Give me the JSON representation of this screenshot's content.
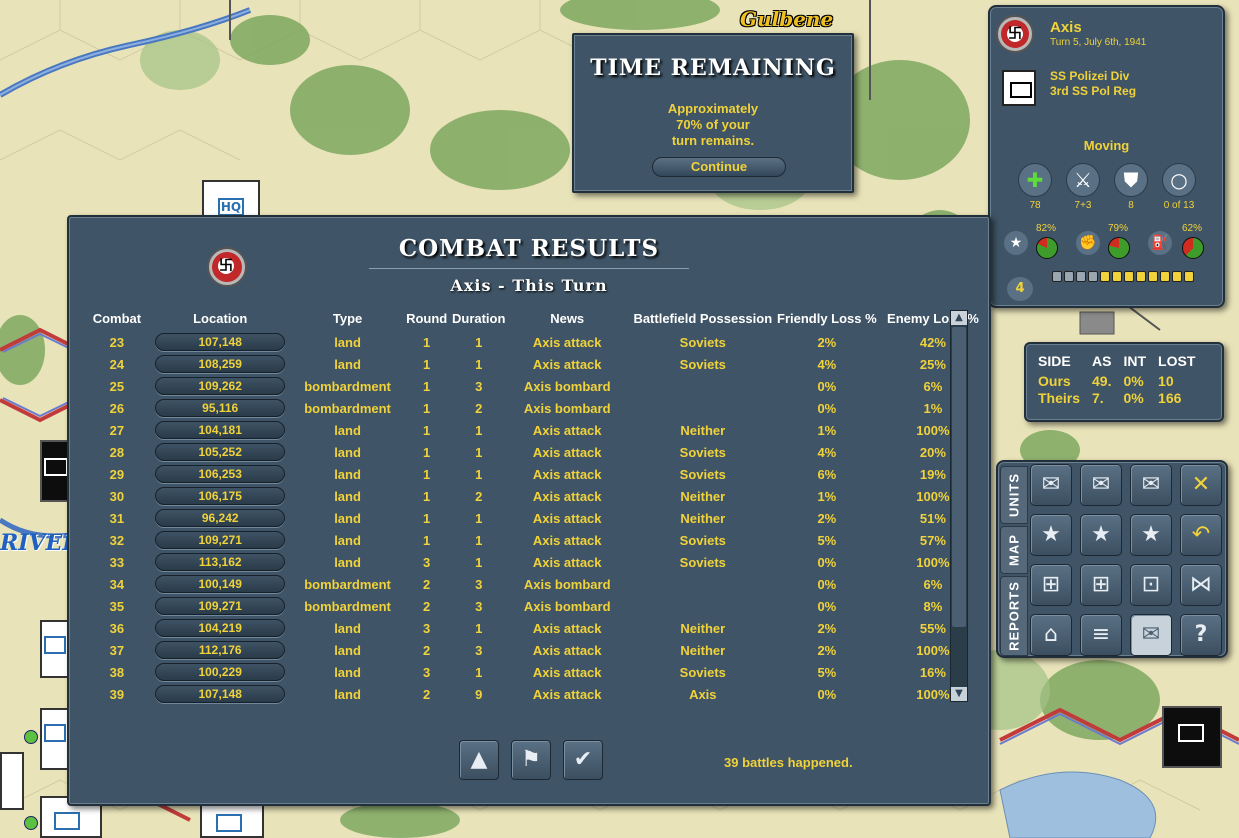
{
  "map": {
    "city_label": "Gulbene",
    "river_label": "RIVER"
  },
  "time_dialog": {
    "title": "TIME REMAINING",
    "line1": "Approximately",
    "line2": "70% of your",
    "line3": "turn remains.",
    "continue_label": "Continue"
  },
  "unit_panel": {
    "side": "Axis",
    "turn": "Turn 5, July 6th, 1941",
    "unit_line1": "SS Polizei Div",
    "unit_line2": "3rd SS Pol Reg",
    "status": "Moving",
    "stats": [
      {
        "icon": "health-cross-icon",
        "value": "78"
      },
      {
        "icon": "crossed-swords-icon",
        "value": "7+3"
      },
      {
        "icon": "shield-icon",
        "value": "8"
      },
      {
        "icon": "circle-icon",
        "value": "0 of 13"
      }
    ],
    "percentages": [
      {
        "icon": "star-icon",
        "value": "82%",
        "fraction": 0.82
      },
      {
        "icon": "fist-icon",
        "value": "79%",
        "fraction": 0.79
      },
      {
        "icon": "fuel-can-icon",
        "value": "62%",
        "fraction": 0.62
      }
    ],
    "morale": "4",
    "supply_segments": {
      "filled": 8,
      "total": 12
    }
  },
  "summary": {
    "headers": [
      "SIDE",
      "AS",
      "INT",
      "LOST"
    ],
    "rows": [
      [
        "Ours",
        "49.",
        "0%",
        "10"
      ],
      [
        "Theirs",
        "7.",
        "0%",
        "166"
      ]
    ]
  },
  "command_tabs": [
    "UNITS",
    "MAP",
    "REPORTS"
  ],
  "combat": {
    "title": "COMBAT RESULTS",
    "subtitle": "Axis - This Turn",
    "headers": [
      "Combat",
      "Location",
      "Type",
      "Round",
      "Duration",
      "News",
      "Battlefield Possession",
      "Friendly Loss %",
      "Enemy Loss %"
    ],
    "rows": [
      [
        "23",
        "107,148",
        "land",
        "1",
        "1",
        "Axis attack",
        "Soviets",
        "2%",
        "42%"
      ],
      [
        "24",
        "108,259",
        "land",
        "1",
        "1",
        "Axis attack",
        "Soviets",
        "4%",
        "25%"
      ],
      [
        "25",
        "109,262",
        "bombardment",
        "1",
        "3",
        "Axis bombard",
        "",
        "0%",
        "6%"
      ],
      [
        "26",
        "95,116",
        "bombardment",
        "1",
        "2",
        "Axis bombard",
        "",
        "0%",
        "1%"
      ],
      [
        "27",
        "104,181",
        "land",
        "1",
        "1",
        "Axis attack",
        "Neither",
        "1%",
        "100%"
      ],
      [
        "28",
        "105,252",
        "land",
        "1",
        "1",
        "Axis attack",
        "Soviets",
        "4%",
        "20%"
      ],
      [
        "29",
        "106,253",
        "land",
        "1",
        "1",
        "Axis attack",
        "Soviets",
        "6%",
        "19%"
      ],
      [
        "30",
        "106,175",
        "land",
        "1",
        "2",
        "Axis attack",
        "Neither",
        "1%",
        "100%"
      ],
      [
        "31",
        "96,242",
        "land",
        "1",
        "1",
        "Axis attack",
        "Neither",
        "2%",
        "51%"
      ],
      [
        "32",
        "109,271",
        "land",
        "1",
        "1",
        "Axis attack",
        "Soviets",
        "5%",
        "57%"
      ],
      [
        "33",
        "113,162",
        "land",
        "3",
        "1",
        "Axis attack",
        "Soviets",
        "0%",
        "100%"
      ],
      [
        "34",
        "100,149",
        "bombardment",
        "2",
        "3",
        "Axis bombard",
        "",
        "0%",
        "6%"
      ],
      [
        "35",
        "109,271",
        "bombardment",
        "2",
        "3",
        "Axis bombard",
        "",
        "0%",
        "8%"
      ],
      [
        "36",
        "104,219",
        "land",
        "3",
        "1",
        "Axis attack",
        "Neither",
        "2%",
        "55%"
      ],
      [
        "37",
        "112,176",
        "land",
        "2",
        "3",
        "Axis attack",
        "Neither",
        "2%",
        "100%"
      ],
      [
        "38",
        "100,229",
        "land",
        "3",
        "1",
        "Axis attack",
        "Soviets",
        "5%",
        "16%"
      ],
      [
        "39",
        "107,148",
        "land",
        "2",
        "9",
        "Axis attack",
        "Axis",
        "0%",
        "100%"
      ]
    ],
    "footer": "39 battles happened."
  },
  "colors": {
    "panel": "#3f5466",
    "text_yellow": "#f0d23a",
    "map_bg": "#e8e2b8"
  }
}
